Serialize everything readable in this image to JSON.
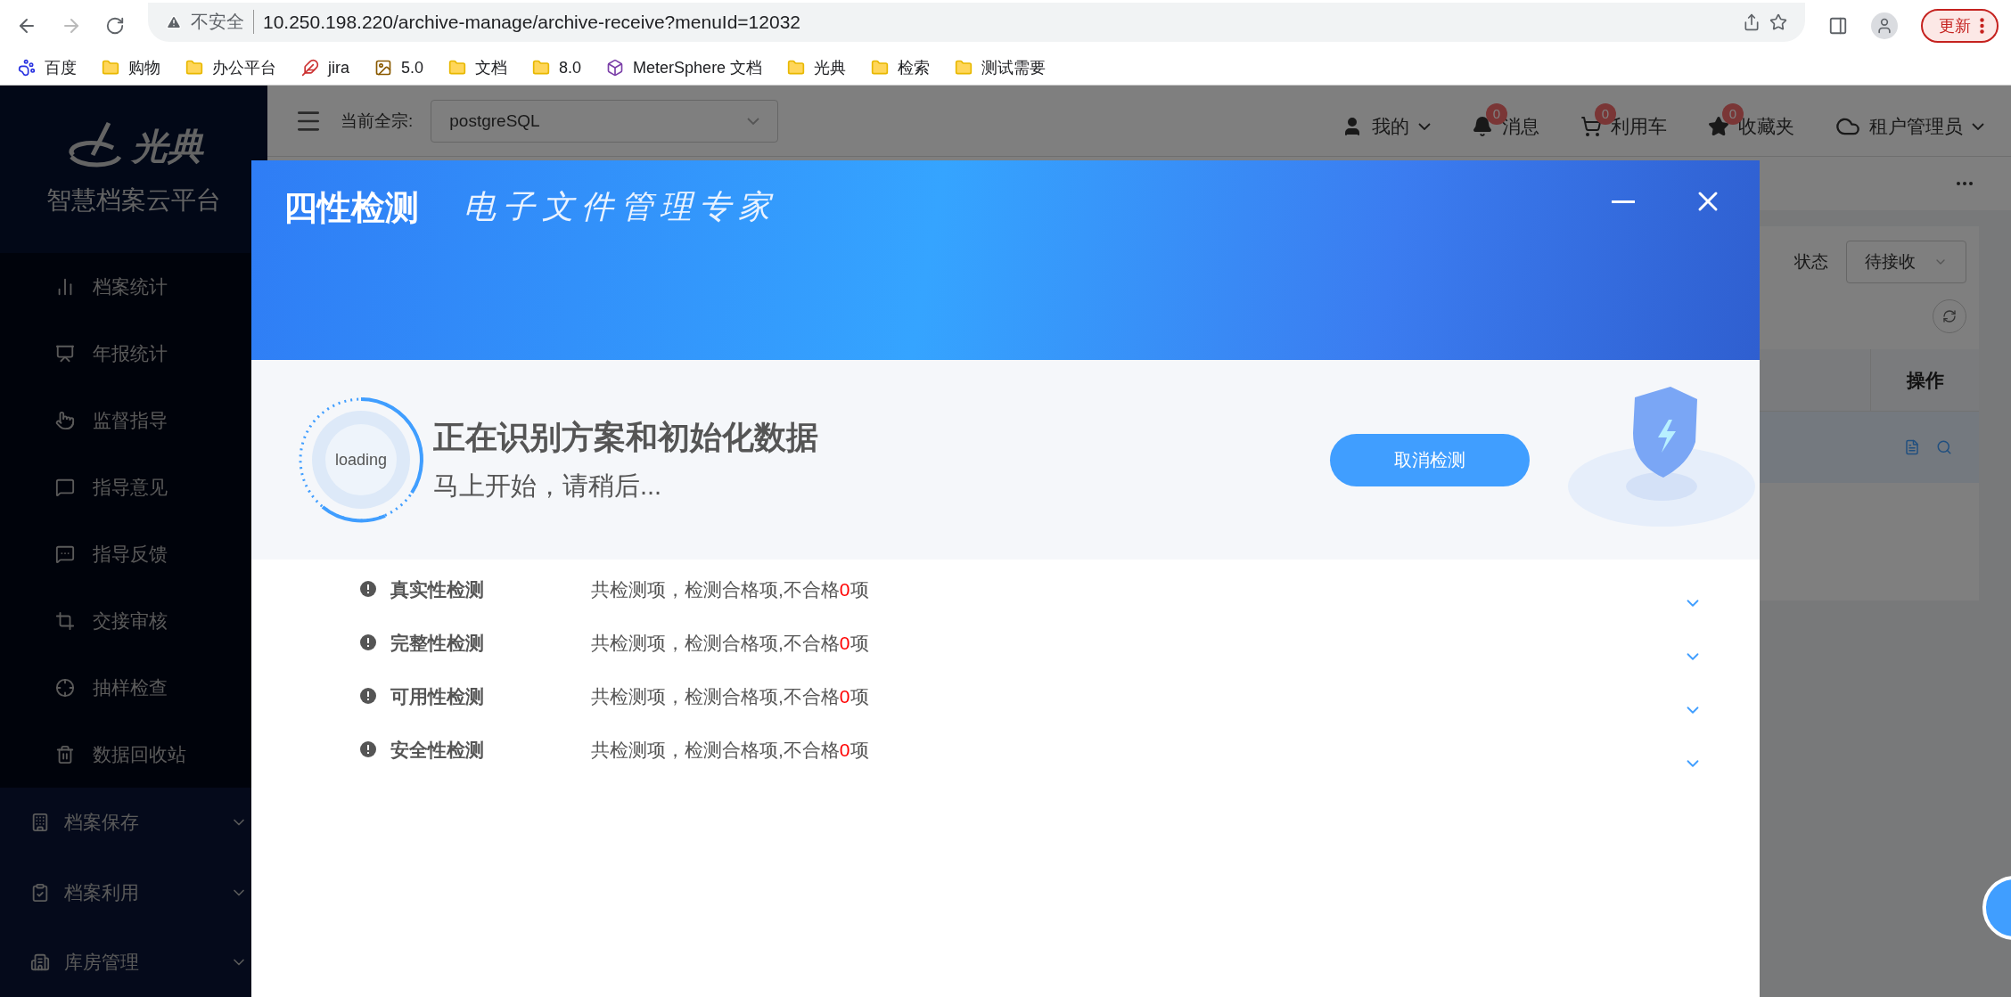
{
  "browser": {
    "security_label": "不安全",
    "url": "10.250.198.220/archive-manage/archive-receive?menuId=12032",
    "update_button": "更新",
    "bookmarks": [
      {
        "label": "百度",
        "kind": "paw"
      },
      {
        "label": "购物",
        "kind": "folder"
      },
      {
        "label": "办公平台",
        "kind": "folder"
      },
      {
        "label": "jira",
        "kind": "logo"
      },
      {
        "label": "5.0",
        "kind": "picture"
      },
      {
        "label": "文档",
        "kind": "folder"
      },
      {
        "label": "8.0",
        "kind": "folder"
      },
      {
        "label": "MeterSphere 文档",
        "kind": "cube"
      },
      {
        "label": "光典",
        "kind": "folder"
      },
      {
        "label": "检索",
        "kind": "folder"
      },
      {
        "label": "测试需要",
        "kind": "folder"
      }
    ]
  },
  "sidebar": {
    "logo_text": "光典",
    "platform_name": "智慧档案云平台",
    "submenu_items": [
      {
        "label": "档案统计"
      },
      {
        "label": "年报统计"
      },
      {
        "label": "监督指导"
      },
      {
        "label": "指导意见"
      },
      {
        "label": "指导反馈"
      },
      {
        "label": "交接审核"
      },
      {
        "label": "抽样检查"
      },
      {
        "label": "数据回收站"
      }
    ],
    "groups": [
      {
        "label": "档案保存",
        "expanded": false
      },
      {
        "label": "档案利用",
        "expanded": false
      },
      {
        "label": "库房管理",
        "expanded": false
      }
    ]
  },
  "header": {
    "fonds_label": "当前全宗:",
    "fonds_value": "postgreSQL",
    "user_menu": "我的",
    "shortcuts": [
      {
        "label": "消息",
        "badge": "0"
      },
      {
        "label": "利用车",
        "badge": "0"
      },
      {
        "label": "收藏夹",
        "badge": "0"
      }
    ],
    "tenant": "租户管理员"
  },
  "filter": {
    "label": "状态",
    "value": "待接收"
  },
  "table": {
    "columns": [
      "操作"
    ],
    "rows": [
      {
        "selected": true
      }
    ]
  },
  "modal": {
    "title": "四性检测",
    "slogan": "电子文件管理专家",
    "progress": {
      "ring_label": "loading",
      "heading": "正在识别方案和初始化数据",
      "subtext": "马上开始，请稍后...",
      "cancel_button": "取消检测"
    },
    "checks": [
      {
        "name": "真实性检测",
        "summary": "共检测项，检测合格项,不合格",
        "failed": "0",
        "unit": "项",
        "expanded": false
      },
      {
        "name": "完整性检测",
        "summary": "共检测项，检测合格项,不合格",
        "failed": "0",
        "unit": "项",
        "expanded": false
      },
      {
        "name": "可用性检测",
        "summary": "共检测项，检测合格项,不合格",
        "failed": "0",
        "unit": "项",
        "expanded": false
      },
      {
        "name": "安全性检测",
        "summary": "共检测项，检测合格项,不合格",
        "failed": "0",
        "unit": "项",
        "expanded": false
      }
    ]
  }
}
